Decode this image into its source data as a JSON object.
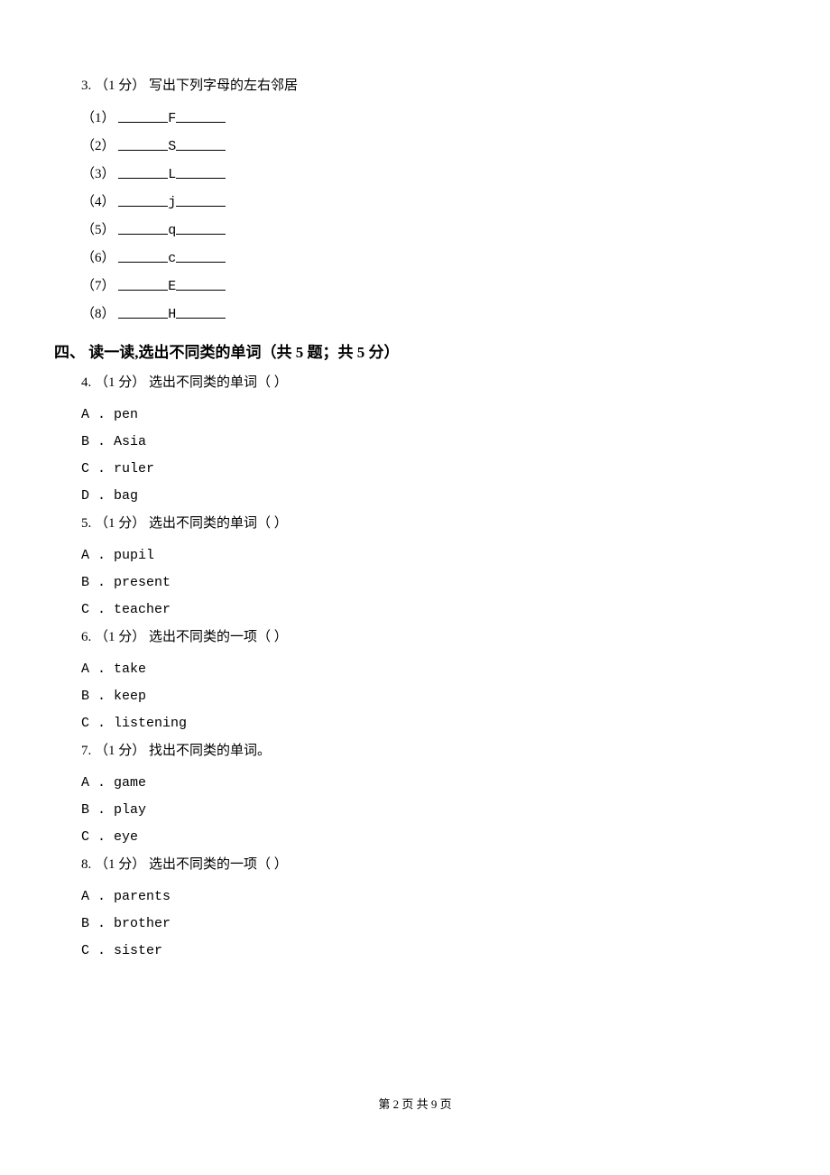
{
  "question3": {
    "prompt": "3. （1 分） 写出下列字母的左右邻居",
    "subs": [
      {
        "num": "（1）",
        "letter": "F"
      },
      {
        "num": "（2）",
        "letter": "S"
      },
      {
        "num": "（3）",
        "letter": "L"
      },
      {
        "num": "（4）",
        "letter": "j"
      },
      {
        "num": "（5）",
        "letter": "q"
      },
      {
        "num": "（6）",
        "letter": "c"
      },
      {
        "num": "（7）",
        "letter": "E"
      },
      {
        "num": "（8）",
        "letter": "H"
      }
    ]
  },
  "sectionHeader": "四、 读一读,选出不同类的单词（共 5 题；共 5 分）",
  "question4": {
    "prompt": "4. （1 分） 选出不同类的单词（   ）",
    "options": [
      "A . pen",
      "B . Asia",
      "C . ruler",
      "D . bag"
    ]
  },
  "question5": {
    "prompt": "5. （1 分） 选出不同类的单词（   ）",
    "options": [
      "A . pupil",
      "B . present",
      "C . teacher"
    ]
  },
  "question6": {
    "prompt": "6. （1 分） 选出不同类的一项（   ）",
    "options": [
      "A . take",
      "B . keep",
      "C . listening"
    ]
  },
  "question7": {
    "prompt": "7. （1 分） 找出不同类的单词。",
    "options": [
      "A . game",
      "B . play",
      "C . eye"
    ]
  },
  "question8": {
    "prompt": "8. （1 分） 选出不同类的一项（   ）",
    "options": [
      "A . parents",
      "B . brother",
      "C . sister"
    ]
  },
  "footer": "第 2 页 共 9 页"
}
